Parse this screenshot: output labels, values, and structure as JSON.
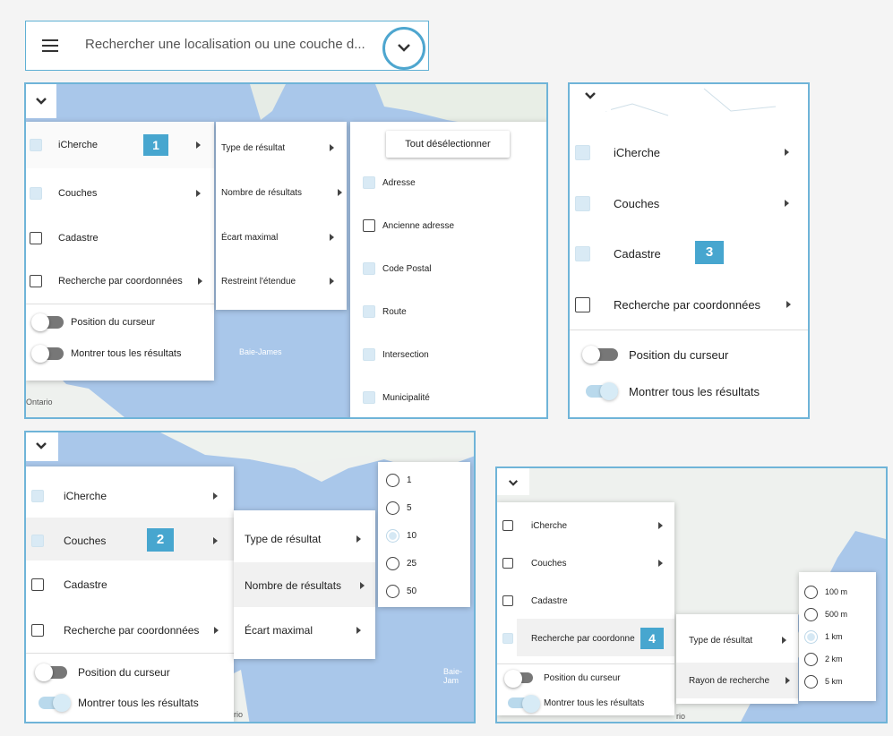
{
  "search": {
    "placeholder": "Rechercher une localisation ou une couche d..."
  },
  "menu": {
    "icherche": "iCherche",
    "couches": "Couches",
    "cadastre": "Cadastre",
    "recherche_coord": "Recherche par coordonnées",
    "recherche_coord_trunc": "Recherche par coordonne",
    "position_curseur": "Position du curseur",
    "montrer_tous": "Montrer tous les résultats"
  },
  "submenu": {
    "type_resultat": "Type de résultat",
    "nombre_resultats": "Nombre de résultats",
    "ecart_maximal": "Écart maximal",
    "restreint_etendue": "Restreint l'étendue",
    "rayon_recherche": "Rayon de recherche"
  },
  "types": {
    "deselect_all": "Tout désélectionner",
    "items": [
      "Adresse",
      "Ancienne adresse",
      "Code Postal",
      "Route",
      "Intersection",
      "Municipalité"
    ],
    "checked": [
      true,
      false,
      true,
      true,
      true,
      true
    ]
  },
  "counts": {
    "options": [
      "1",
      "5",
      "10",
      "25",
      "50"
    ],
    "selected": "10"
  },
  "radius": {
    "options": [
      "100 m",
      "500 m",
      "1 km",
      "2 km",
      "5 km"
    ],
    "selected": "1 km"
  },
  "badges": [
    "1",
    "2",
    "3",
    "4"
  ],
  "map_labels": {
    "ontario": "Ontario",
    "rio": "rio",
    "baie_james": "Baie-James",
    "baie_jam": "Baie-Jam"
  },
  "colors": {
    "accent": "#47a6cf",
    "frame": "#6fb4d8",
    "water": "#a9c7ea",
    "land": "#eef2ee"
  }
}
